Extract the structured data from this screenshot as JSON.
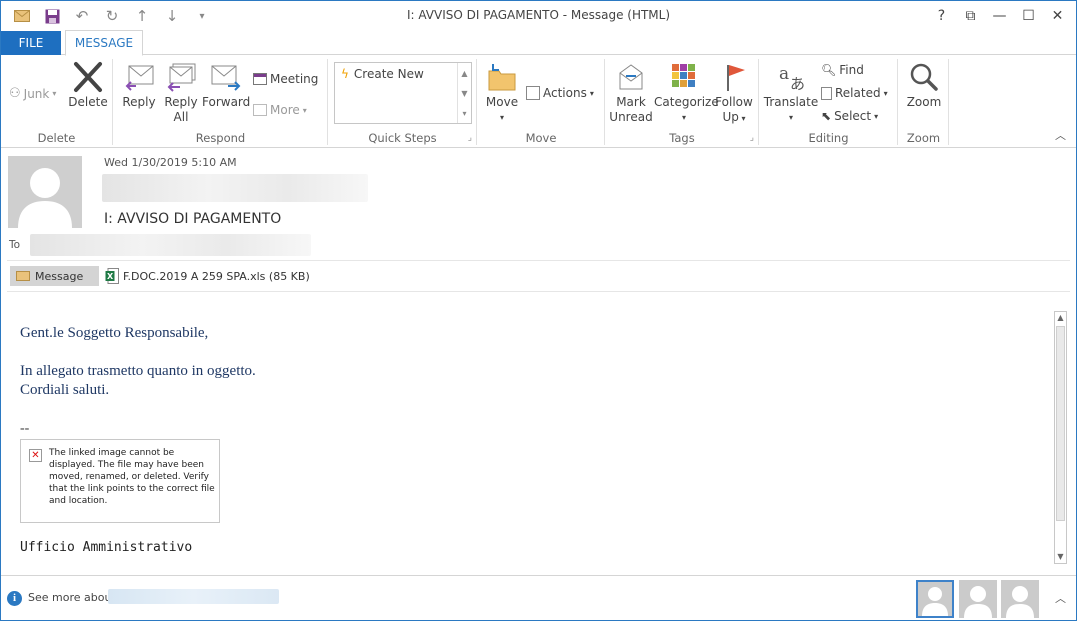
{
  "window": {
    "title": "I: AVVISO DI PAGAMENTO - Message (HTML)",
    "controls": {
      "help": "?",
      "restore_ribbon": "⧉",
      "minimize": "—",
      "maximize": "☐",
      "close": "✕"
    }
  },
  "qat": {
    "icons": [
      "mail-icon",
      "save-icon",
      "undo-icon",
      "redo-icon",
      "up-icon",
      "down-icon",
      "customize-icon"
    ]
  },
  "tabs": {
    "file": "FILE",
    "message": "MESSAGE"
  },
  "ribbon": {
    "delete_group": {
      "label": "Delete",
      "junk": "Junk",
      "delete": "Delete"
    },
    "respond_group": {
      "label": "Respond",
      "reply": "Reply",
      "reply_all_1": "Reply",
      "reply_all_2": "All",
      "forward": "Forward",
      "meeting": "Meeting",
      "more": "More"
    },
    "quick_steps_group": {
      "label": "Quick Steps",
      "create_new": "Create New"
    },
    "move_group": {
      "label": "Move",
      "move": "Move",
      "actions": "Actions"
    },
    "tags_group": {
      "label": "Tags",
      "mark_unread_1": "Mark",
      "mark_unread_2": "Unread",
      "categorize": "Categorize",
      "follow_up_1": "Follow",
      "follow_up_2": "Up"
    },
    "editing_group": {
      "label": "Editing",
      "translate": "Translate",
      "find": "Find",
      "related": "Related",
      "select": "Select"
    },
    "zoom_group": {
      "label": "Zoom",
      "zoom": "Zoom"
    }
  },
  "header": {
    "date": "Wed 1/30/2019 5:10 AM",
    "subject": "I: AVVISO DI PAGAMENTO",
    "to_label": "To"
  },
  "attachments": {
    "message": "Message",
    "file": "F.DOC.2019 A 259 SPA.xls (85 KB)"
  },
  "body": {
    "greeting": "Gent.le Soggetto Responsabile,",
    "line1": "In allegato trasmetto quanto in oggetto.",
    "line2": "Cordiali saluti.",
    "sig_dash": "--",
    "broken_image_text": "The linked image cannot be displayed.  The file may have been moved, renamed, or deleted. Verify that the link points to the correct file and location.",
    "office": "Ufficio Amministrativo"
  },
  "people_pane": {
    "see_more": "See more about"
  },
  "colors": {
    "accent": "#1e6fc0",
    "body_text": "#1f3864"
  }
}
